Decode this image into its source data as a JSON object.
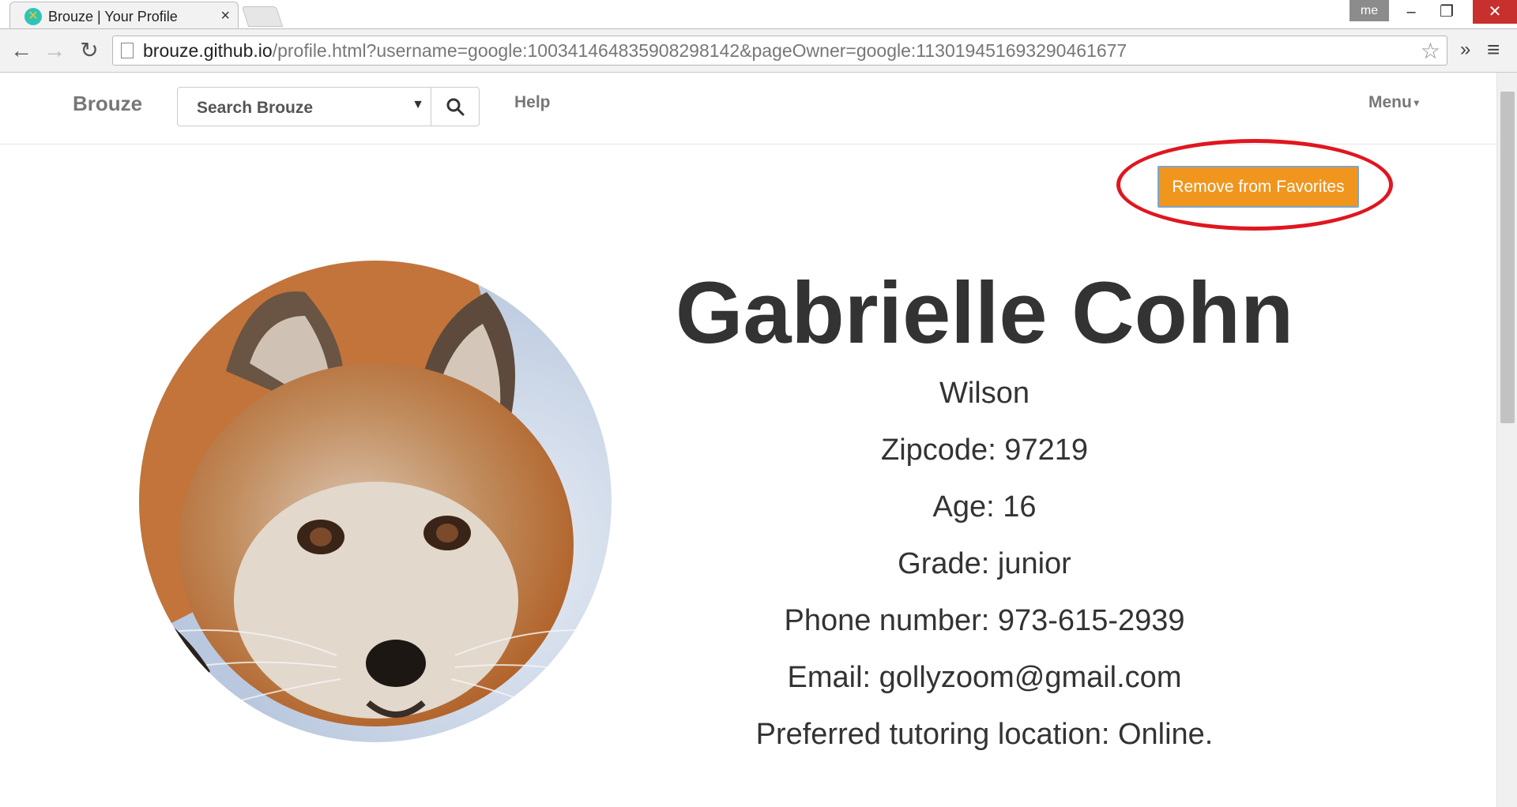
{
  "browser": {
    "tab_title": "Brouze | Your Profile",
    "tab_close": "×",
    "user_label": "me",
    "url_host": "brouze.github.io",
    "url_path": "/profile.html?username=google:100341464835908298142&pageOwner=google:113019451693290461677",
    "icons": {
      "back": "arrow-left-icon",
      "forward": "arrow-right-icon",
      "reload": "reload-icon",
      "bookmark": "star-icon",
      "extensions": "chevron-double-right-icon",
      "menu": "hamburger-icon"
    }
  },
  "navbar": {
    "brand": "Brouze",
    "search_label": "Search Brouze",
    "help": "Help",
    "menu": "Menu"
  },
  "favorites_button": "Remove from Favorites",
  "annotation_color": "#e0161f",
  "accent_color": "#f0961e",
  "profile": {
    "name": "Gabrielle Cohn",
    "school": "Wilson",
    "zipcode": "Zipcode: 97219",
    "age": "Age: 16",
    "grade": "Grade: junior",
    "phone": "Phone number: 973-615-2939",
    "email": "Email: gollyzoom@gmail.com",
    "location": "Preferred tutoring location: Online."
  }
}
